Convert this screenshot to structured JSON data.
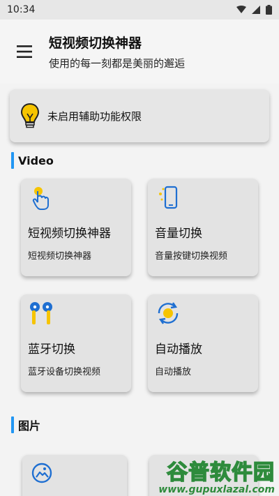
{
  "status_bar": {
    "time": "10:34"
  },
  "header": {
    "title": "短视频切换神器",
    "subtitle": "使用的每一刻都是美丽的邂逅"
  },
  "accessibility": {
    "text": "未启用辅助功能权限"
  },
  "sections": [
    {
      "title": "Video"
    },
    {
      "title": "图片"
    }
  ],
  "video_cards": [
    {
      "title": "短视频切换神器",
      "desc": "短视频切换神器",
      "icon": "tap-hand-icon"
    },
    {
      "title": "音量切换",
      "desc": "音量按键切换视频",
      "icon": "phone-volume-icon"
    },
    {
      "title": "蓝牙切换",
      "desc": "蓝牙设备切换视频",
      "icon": "earbuds-icon"
    },
    {
      "title": "自动播放",
      "desc": "自动播放",
      "icon": "auto-rotate-icon"
    }
  ],
  "image_cards": [
    {
      "icon": "image-icon"
    }
  ],
  "watermark": {
    "main": "谷普软件园",
    "url": "www.gupuxlazal.com"
  },
  "colors": {
    "accent": "#2196f3",
    "icon_yellow": "#f6c400",
    "watermark_green": "#2e8b3c"
  }
}
